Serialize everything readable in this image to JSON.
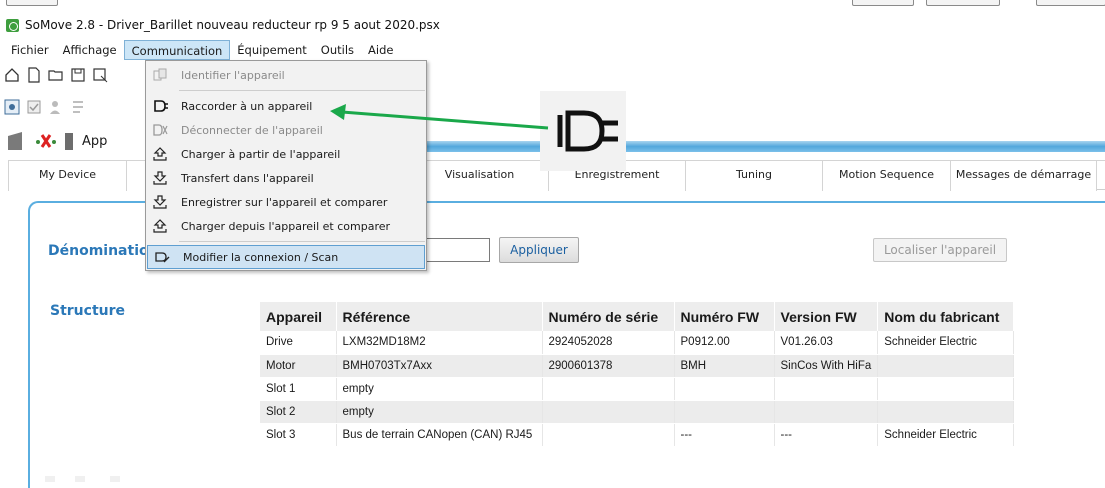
{
  "window": {
    "title": "SoMove 2.8 - Driver_Barillet nouveau reducteur rp 9 5 aout 2020.psx"
  },
  "menubar": {
    "items": [
      "Fichier",
      "Affichage",
      "Communication",
      "Équipement",
      "Outils",
      "Aide"
    ],
    "active": "Communication"
  },
  "toolbar": {
    "partial_label": "App"
  },
  "tabs": [
    "My Device",
    "",
    "Visualisation",
    "Enregistrement",
    "Tuning",
    "Motion Sequence",
    "Messages de démarrage"
  ],
  "communication_menu": {
    "items": [
      {
        "label": "Identifier l'appareil",
        "icon": "identify-icon",
        "enabled": false
      },
      {
        "label": "Raccorder à un appareil",
        "icon": "plug-connect-icon",
        "enabled": true
      },
      {
        "label": "Déconnecter de l'appareil",
        "icon": "plug-disconnect-icon",
        "enabled": false
      },
      {
        "label": "Charger à partir de l'appareil",
        "icon": "upload-icon",
        "enabled": true
      },
      {
        "label": "Transfert dans l'appareil",
        "icon": "download-icon",
        "enabled": true
      },
      {
        "label": "Enregistrer sur l'appareil et comparer",
        "icon": "download-compare-icon",
        "enabled": true
      },
      {
        "label": "Charger depuis l'appareil et comparer",
        "icon": "upload-compare-icon",
        "enabled": true
      },
      {
        "label": "Modifier la connexion / Scan",
        "icon": "scan-icon",
        "enabled": true,
        "highlighted": true
      }
    ]
  },
  "device_panel": {
    "denomination_label": "Dénominatio",
    "apply_button": "Appliquer",
    "locate_button": "Localiser l'appareil",
    "structure_label": "Structure"
  },
  "structure_table": {
    "headers": [
      "Appareil",
      "Référence",
      "Numéro de série",
      "Numéro FW",
      "Version FW",
      "Nom du fabricant"
    ],
    "rows": [
      [
        "Drive",
        "LXM32MD18M2",
        "2924052028",
        "P0912.00",
        "V01.26.03",
        "Schneider Electric"
      ],
      [
        "Motor",
        "BMH0703Tx7Axx",
        "2900601378",
        "BMH",
        "SinCos With HiFa",
        ""
      ],
      [
        "Slot 1",
        "empty",
        "",
        "",
        "",
        ""
      ],
      [
        "Slot 2",
        "empty",
        "",
        "",
        "",
        ""
      ],
      [
        "Slot 3",
        "Bus de terrain CANopen (CAN) RJ45",
        "",
        "---",
        "---",
        "Schneider Electric"
      ]
    ]
  },
  "colors": {
    "accent_blue": "#2b78b8",
    "annotation_arrow": "#1aa84a",
    "menu_highlight": "#cfe3f3"
  }
}
